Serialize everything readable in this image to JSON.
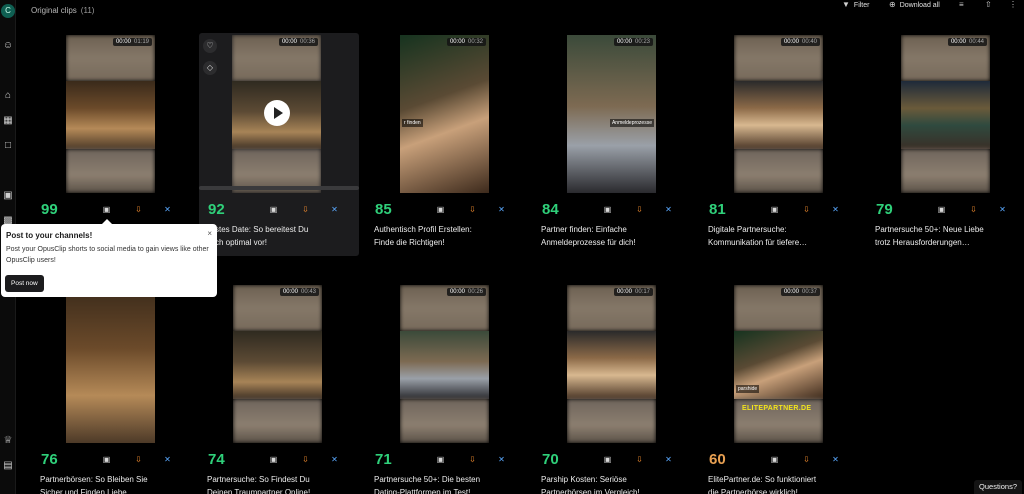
{
  "rail": {
    "avatar_letter": "C",
    "icons": [
      "add-person-icon",
      "home-icon",
      "apps-icon",
      "folder-icon",
      "calendar-icon",
      "briefcase-icon",
      "crown-icon",
      "book-icon"
    ]
  },
  "header": {
    "title": "Original clips",
    "count": "(11)",
    "filter_label": "Filter",
    "download_all_label": "Download all"
  },
  "clips": [
    {
      "score": "99",
      "time": "00:00",
      "duration": "01:19",
      "title": "",
      "score_color": "green"
    },
    {
      "score": "92",
      "time": "00:00",
      "duration": "00:36",
      "title": "…stes Date: So bereitest Du\n…ch optimal vor!",
      "score_color": "green"
    },
    {
      "score": "85",
      "time": "00:00",
      "duration": "00:32",
      "title": "Authentisch Profil Erstellen:\nFinde die Richtigen!",
      "caption": "r finden",
      "score_color": "green"
    },
    {
      "score": "84",
      "time": "00:00",
      "duration": "00:23",
      "title": "Partner finden: Einfache\nAnmeldeprozesse für dich!",
      "caption": "Anmeldeprozesse",
      "score_color": "green"
    },
    {
      "score": "81",
      "time": "00:00",
      "duration": "00:40",
      "title": "Digitale Partnersuche:\nKommunikation für tiefere…",
      "score_color": "green"
    },
    {
      "score": "79",
      "time": "00:00",
      "duration": "00:44",
      "title": "Partnersuche 50+: Neue Liebe\ntrotz Herausforderungen…",
      "score_color": "green"
    },
    {
      "score": "76",
      "time": "",
      "duration": "",
      "title": "Partnerbörsen: So Bleiben Sie\nSicher und Finden Liebe",
      "score_color": "green"
    },
    {
      "score": "74",
      "time": "00:00",
      "duration": "00:43",
      "title": "Partnersuche: So Findest Du\nDeinen Traumpartner Online!",
      "score_color": "green"
    },
    {
      "score": "71",
      "time": "00:00",
      "duration": "00:26",
      "title": "Partnersuche 50+: Die besten\nDating-Plattformen im Test!",
      "score_color": "green"
    },
    {
      "score": "70",
      "time": "00:00",
      "duration": "00:17",
      "title": "Parship Kosten: Seriöse\nPartnerbörsen im Vergleich!",
      "score_color": "green"
    },
    {
      "score": "60",
      "time": "00:00",
      "duration": "00:37",
      "title": "ElitePartner.de: So funktioniert\ndie Partnerbörse wirklich!",
      "caption": "parshide",
      "brand": "ELITEPARTNER.DE",
      "score_color": "amber"
    }
  ],
  "popover": {
    "title": "Post to your channels!",
    "body": "Post your OpusClip shorts to social media to gain views like other OpusClip users!",
    "button": "Post now",
    "close_glyph": "×"
  },
  "help": {
    "label": "Questions?"
  },
  "playback_progress": 0,
  "colors": {
    "score_green": "#2fd07a",
    "score_amber": "#e8a052",
    "download_orange": "#f08a2e",
    "edit_blue": "#5aa9ff"
  }
}
